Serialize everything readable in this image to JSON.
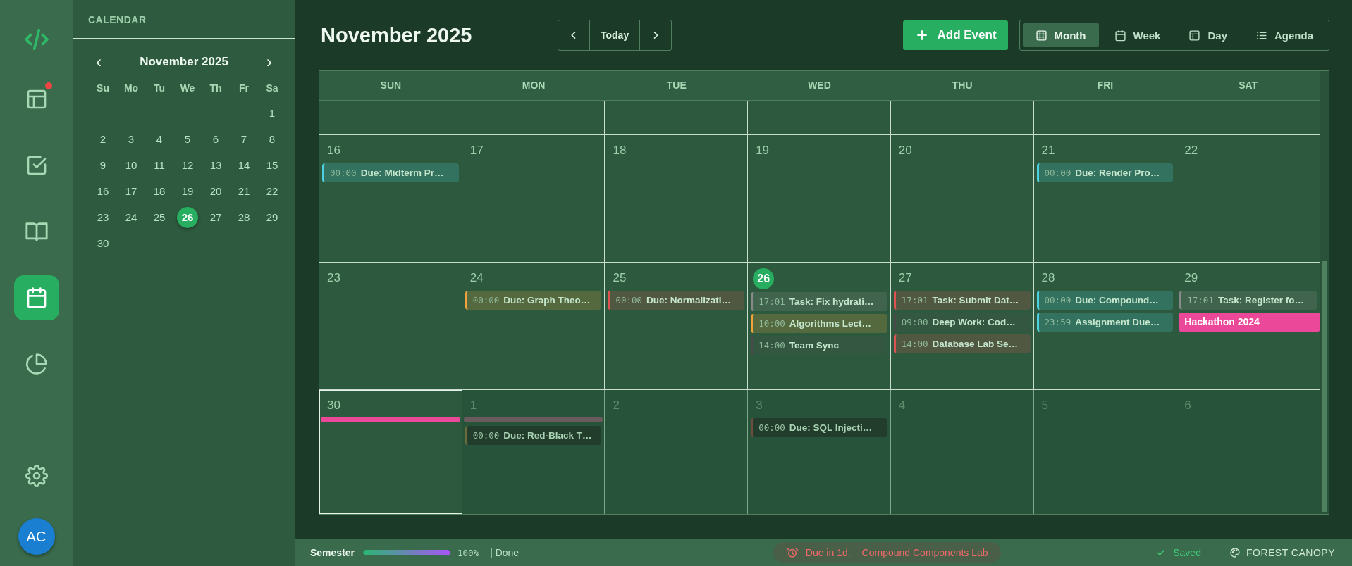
{
  "nav": [
    {
      "kind": "logo",
      "selected": false,
      "badge": false
    },
    {
      "kind": "dashboard",
      "selected": false,
      "badge": true
    },
    {
      "kind": "tasks",
      "selected": false,
      "badge": false
    },
    {
      "kind": "notes",
      "selected": false,
      "badge": false
    },
    {
      "kind": "calendar",
      "selected": true,
      "badge": false
    },
    {
      "kind": "stats",
      "selected": false,
      "badge": false
    }
  ],
  "nav_bottom": {
    "avatar": "AC"
  },
  "mini_calendar": {
    "panel_title": "CALENDAR",
    "month": "November 2025",
    "prev": "‹",
    "next": "›",
    "weekdays": [
      "Su",
      "Mo",
      "Tu",
      "We",
      "Th",
      "Fr",
      "Sa"
    ],
    "weeks": [
      [
        {
          "day": "1",
          "today": false
        }
      ],
      [
        {
          "day": "2",
          "today": false
        },
        {
          "day": "3",
          "today": false
        },
        {
          "day": "4",
          "today": false
        },
        {
          "day": "5",
          "today": false
        },
        {
          "day": "6",
          "today": false
        },
        {
          "day": "7",
          "today": false
        },
        {
          "day": "8",
          "today": false
        }
      ],
      [
        {
          "day": "9",
          "today": false
        },
        {
          "day": "10",
          "today": false
        },
        {
          "day": "11",
          "today": false
        },
        {
          "day": "12",
          "today": false
        },
        {
          "day": "13",
          "today": false
        },
        {
          "day": "14",
          "today": false
        },
        {
          "day": "15",
          "today": false
        }
      ],
      [
        {
          "day": "16",
          "today": false
        },
        {
          "day": "17",
          "today": false
        },
        {
          "day": "18",
          "today": false
        },
        {
          "day": "19",
          "today": false
        },
        {
          "day": "20",
          "today": false
        },
        {
          "day": "21",
          "today": false
        },
        {
          "day": "22",
          "today": false
        }
      ],
      [
        {
          "day": "23",
          "today": false
        },
        {
          "day": "24",
          "today": false
        },
        {
          "day": "25",
          "today": false
        },
        {
          "day": "26",
          "today": true
        },
        {
          "day": "27",
          "today": false
        },
        {
          "day": "28",
          "today": false
        },
        {
          "day": "29",
          "today": false
        }
      ],
      [
        {
          "day": "30",
          "today": false
        }
      ]
    ]
  },
  "header": {
    "title": "November 2025",
    "today_button": "Today",
    "add_button": "Add Event",
    "views": [
      {
        "label": "Month",
        "kind": "month",
        "selected": true
      },
      {
        "label": "Week",
        "kind": "week",
        "selected": false
      },
      {
        "label": "Day",
        "kind": "day",
        "selected": false
      },
      {
        "label": "Agenda",
        "kind": "agenda",
        "selected": false
      }
    ]
  },
  "grid": {
    "columns": [
      "SUN",
      "MON",
      "TUE",
      "WED",
      "THU",
      "FRI",
      "SAT"
    ],
    "weeks": [
      {
        "days": [
          {
            "day": "16",
            "in_month": true,
            "today": false,
            "selected": false,
            "events": [
              {
                "kind": "timed",
                "time": "00:00",
                "title": "Due: Midterm Pr…",
                "color": "#4dd0e1"
              }
            ]
          },
          {
            "day": "17",
            "in_month": true,
            "today": false,
            "selected": false
          },
          {
            "day": "18",
            "in_month": true,
            "today": false,
            "selected": false
          },
          {
            "day": "19",
            "in_month": true,
            "today": false,
            "selected": false
          },
          {
            "day": "20",
            "in_month": true,
            "today": false,
            "selected": false
          },
          {
            "day": "21",
            "in_month": true,
            "today": false,
            "selected": false,
            "events": [
              {
                "kind": "timed",
                "time": "00:00",
                "title": "Due: Render Pro…",
                "color": "#4dd0e1"
              }
            ]
          },
          {
            "day": "22",
            "in_month": true,
            "today": false,
            "selected": false
          }
        ]
      },
      {
        "days": [
          {
            "day": "23",
            "in_month": true,
            "today": false,
            "selected": false
          },
          {
            "day": "24",
            "in_month": true,
            "today": false,
            "selected": false,
            "events": [
              {
                "kind": "timed",
                "time": "00:00",
                "title": "Due: Graph Theo…",
                "color": "#f0a33a"
              }
            ]
          },
          {
            "day": "25",
            "in_month": true,
            "today": false,
            "selected": false,
            "events": [
              {
                "kind": "timed",
                "time": "00:00",
                "title": "Due: Normalizati…",
                "color": "#e05252"
              }
            ]
          },
          {
            "day": "26",
            "in_month": true,
            "today": true,
            "selected": false,
            "events": [
              {
                "kind": "timed",
                "time": "17:01",
                "title": "Task: Fix hydrati…",
                "color": "#8a8a8a"
              },
              {
                "kind": "timed",
                "time": "10:00",
                "title": "Algorithms Lect…",
                "color": "#f0a33a"
              },
              {
                "kind": "timed",
                "time": "14:00",
                "title": "Team Sync",
                "color": "#4a4a4a"
              }
            ]
          },
          {
            "day": "27",
            "in_month": true,
            "today": false,
            "selected": false,
            "events": [
              {
                "kind": "timed",
                "time": "17:01",
                "title": "Task: Submit Dat…",
                "color": "#e05252"
              },
              {
                "kind": "timed",
                "time": "09:00",
                "title": "Deep Work: Cod…",
                "color": "#4a4a4a"
              },
              {
                "kind": "timed",
                "time": "14:00",
                "title": "Database Lab Se…",
                "color": "#e05252"
              }
            ]
          },
          {
            "day": "28",
            "in_month": true,
            "today": false,
            "selected": false,
            "events": [
              {
                "kind": "timed",
                "time": "00:00",
                "title": "Due: Compound…",
                "color": "#4dd0e1"
              },
              {
                "kind": "timed",
                "time": "23:59",
                "title": "Assignment Due…",
                "color": "#4dd0e1"
              }
            ]
          },
          {
            "day": "29",
            "in_month": true,
            "today": false,
            "selected": false,
            "events": [
              {
                "kind": "timed",
                "time": "17:01",
                "title": "Task: Register fo…",
                "color": "#8a8a8a"
              },
              {
                "kind": "allday",
                "title": "Hackathon 2024",
                "color": "#ec4899"
              }
            ]
          }
        ]
      },
      {
        "days": [
          {
            "day": "30",
            "in_month": true,
            "today": false,
            "selected": true,
            "events": [
              {
                "kind": "bar",
                "color": "#ec4899"
              }
            ]
          },
          {
            "day": "1",
            "in_month": false,
            "today": false,
            "selected": false,
            "events": [
              {
                "kind": "bar",
                "color": "#6b5a5e"
              },
              {
                "kind": "timed",
                "time": "00:00",
                "title": "Due: Red-Black T…",
                "color": "#6b6b3c"
              }
            ]
          },
          {
            "day": "2",
            "in_month": false,
            "today": false,
            "selected": false
          },
          {
            "day": "3",
            "in_month": false,
            "today": false,
            "selected": false,
            "events": [
              {
                "kind": "timed",
                "time": "00:00",
                "title": "Due: SQL Injecti…",
                "color": "#6b4f3c"
              }
            ]
          },
          {
            "day": "4",
            "in_month": false,
            "today": false,
            "selected": false
          },
          {
            "day": "5",
            "in_month": false,
            "today": false,
            "selected": false
          },
          {
            "day": "6",
            "in_month": false,
            "today": false,
            "selected": false
          }
        ]
      }
    ]
  },
  "status_bar": {
    "label": "Semester",
    "progress": {
      "level": 1.0
    },
    "percent": "100%",
    "done": "| Done",
    "due_label": "Due in 1d:",
    "due_title": "Compound Components Lab",
    "saved": "Saved",
    "theme": "FOREST CANOPY"
  }
}
